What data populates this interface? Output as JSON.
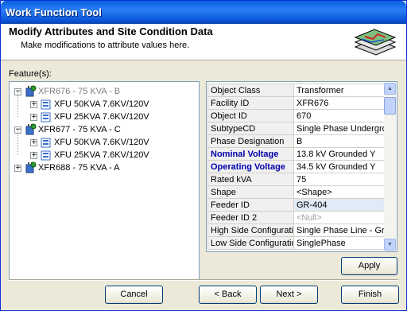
{
  "window": {
    "title": "Work Function Tool"
  },
  "header": {
    "title": "Modify Attributes and Site Condition Data",
    "subtitle": "Make modifications to attribute values here.",
    "icon": "map-layers-icon"
  },
  "features": {
    "label": "Feature(s):",
    "tree": [
      {
        "label": "XFR676 - 75 KVA - B",
        "grayed": true,
        "expander": "−",
        "level": 0
      },
      {
        "label": "XFU 50KVA 7.6KV/120V",
        "grayed": false,
        "expander": "+",
        "level": 1
      },
      {
        "label": "XFU 25KVA 7.6KV/120V",
        "grayed": false,
        "expander": "+",
        "level": 1
      },
      {
        "label": "XFR677 - 75 KVA - C",
        "grayed": false,
        "expander": "−",
        "level": 0
      },
      {
        "label": "XFU 50KVA 7.6KV/120V",
        "grayed": false,
        "expander": "+",
        "level": 1
      },
      {
        "label": "XFU 25KVA 7.6KV/120V",
        "grayed": false,
        "expander": "+",
        "level": 1
      },
      {
        "label": "XFR688 - 75 KVA - A",
        "grayed": false,
        "expander": "+",
        "level": 0
      }
    ]
  },
  "attributes": [
    {
      "name": "Object Class",
      "value": "Transformer",
      "bold": false
    },
    {
      "name": "Facility ID",
      "value": "XFR676",
      "bold": false
    },
    {
      "name": "Object ID",
      "value": "670",
      "bold": false
    },
    {
      "name": "SubtypeCD",
      "value": "Single Phase Undergro",
      "bold": false
    },
    {
      "name": "Phase Designation",
      "value": "B",
      "bold": false
    },
    {
      "name": "Nominal Voltage",
      "value": "13.8 kV Grounded Y",
      "bold": true
    },
    {
      "name": "Operating Voltage",
      "value": "34.5 kV Grounded Y",
      "bold": true
    },
    {
      "name": "Rated kVA",
      "value": "75",
      "bold": false
    },
    {
      "name": "Shape",
      "value": "<Shape>",
      "bold": false
    },
    {
      "name": "Feeder ID",
      "value": "GR-404",
      "bold": false,
      "selected": true
    },
    {
      "name": "Feeder ID 2",
      "value": "<Null>",
      "bold": false,
      "null": true
    },
    {
      "name": "High Side Configuration",
      "value": "Single Phase Line - Gro",
      "bold": false
    },
    {
      "name": "Low Side Configuration",
      "value": "SinglePhase",
      "bold": false
    }
  ],
  "buttons": {
    "apply": "Apply",
    "cancel": "Cancel",
    "back": "< Back",
    "next": "Next >",
    "finish": "Finish"
  }
}
